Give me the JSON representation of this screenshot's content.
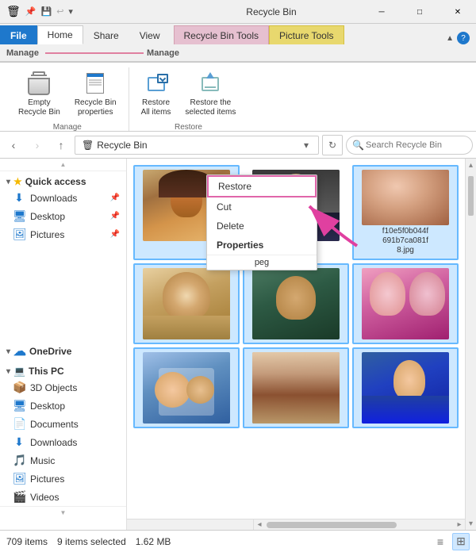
{
  "titleBar": {
    "icon": "🗑",
    "title": "Recycle Bin",
    "controls": [
      "─",
      "□",
      "✕"
    ]
  },
  "ribbonTabs": [
    {
      "label": "File",
      "type": "file"
    },
    {
      "label": "Home",
      "type": "normal"
    },
    {
      "label": "Share",
      "type": "normal"
    },
    {
      "label": "View",
      "type": "normal"
    },
    {
      "label": "Recycle Bin Tools",
      "type": "manage1"
    },
    {
      "label": "Picture Tools",
      "type": "manage2"
    },
    {
      "label": "Manage",
      "type": "manage_active1"
    },
    {
      "label": "Manage",
      "type": "manage_active2"
    }
  ],
  "ribbon": {
    "groups": [
      {
        "name": "Manage",
        "buttons": [
          {
            "icon": "empty",
            "label": "Empty\nRecycle Bin"
          },
          {
            "icon": "properties",
            "label": "Recycle Bin\nproperties"
          }
        ]
      },
      {
        "name": "Restore",
        "buttons": [
          {
            "icon": "restore-all",
            "label": "Restore\nAll items"
          },
          {
            "icon": "restore-selected",
            "label": "Restore the\nselected items"
          }
        ]
      }
    ]
  },
  "addressBar": {
    "backDisabled": false,
    "forwardDisabled": true,
    "upDisabled": false,
    "path": "Recycle Bin",
    "pathIcon": "🗑",
    "searchPlaceholder": "Search Recycle Bin"
  },
  "sidebar": {
    "quickAccess": {
      "label": "Quick access",
      "items": [
        {
          "label": "Downloads",
          "icon": "⬇",
          "color": "#1e78cc",
          "pinned": true
        },
        {
          "label": "Desktop",
          "icon": "🖥",
          "color": "#1e78cc",
          "pinned": true
        },
        {
          "label": "Pictures",
          "icon": "🖼",
          "color": "#1e78cc",
          "pinned": true
        }
      ]
    },
    "oneDrive": {
      "label": "OneDrive",
      "icon": "☁"
    },
    "thisPC": {
      "label": "This PC",
      "icon": "💻",
      "items": [
        {
          "label": "3D Objects",
          "icon": "📦",
          "color": "#8B6914"
        },
        {
          "label": "Desktop",
          "icon": "🖥",
          "color": "#1e78cc"
        },
        {
          "label": "Documents",
          "icon": "📄",
          "color": "#1e78cc"
        },
        {
          "label": "Downloads",
          "icon": "⬇",
          "color": "#1e78cc"
        },
        {
          "label": "Music",
          "icon": "🎵",
          "color": "#8B4513"
        },
        {
          "label": "Pictures",
          "icon": "🖼",
          "color": "#1e78cc"
        },
        {
          "label": "Videos",
          "icon": "🎬",
          "color": "#1e78cc"
        }
      ]
    }
  },
  "contextMenu": {
    "items": [
      {
        "label": "Restore",
        "selected": true
      },
      {
        "label": "Cut"
      },
      {
        "label": "Delete"
      },
      {
        "label": "Properties",
        "bold": true
      }
    ],
    "belowLabel": "peg"
  },
  "files": [
    {
      "selected": true,
      "color": "photo-1",
      "label": ""
    },
    {
      "selected": false,
      "color": "photo-2",
      "label": ""
    },
    {
      "selected": true,
      "color": "photo-3",
      "label": "f10e5f0b044f\n691b7ca081f\n8.jpg"
    },
    {
      "selected": true,
      "color": "photo-4",
      "label": ""
    },
    {
      "selected": true,
      "color": "photo-5",
      "label": ""
    },
    {
      "selected": true,
      "color": "photo-6",
      "label": ""
    },
    {
      "selected": true,
      "color": "photo-7",
      "label": ""
    },
    {
      "selected": true,
      "color": "photo-8",
      "label": ""
    },
    {
      "selected": true,
      "color": "photo-9",
      "label": ""
    }
  ],
  "statusBar": {
    "itemCount": "709 items",
    "selectedCount": "9 items selected",
    "selectedSize": "1.62 MB"
  }
}
